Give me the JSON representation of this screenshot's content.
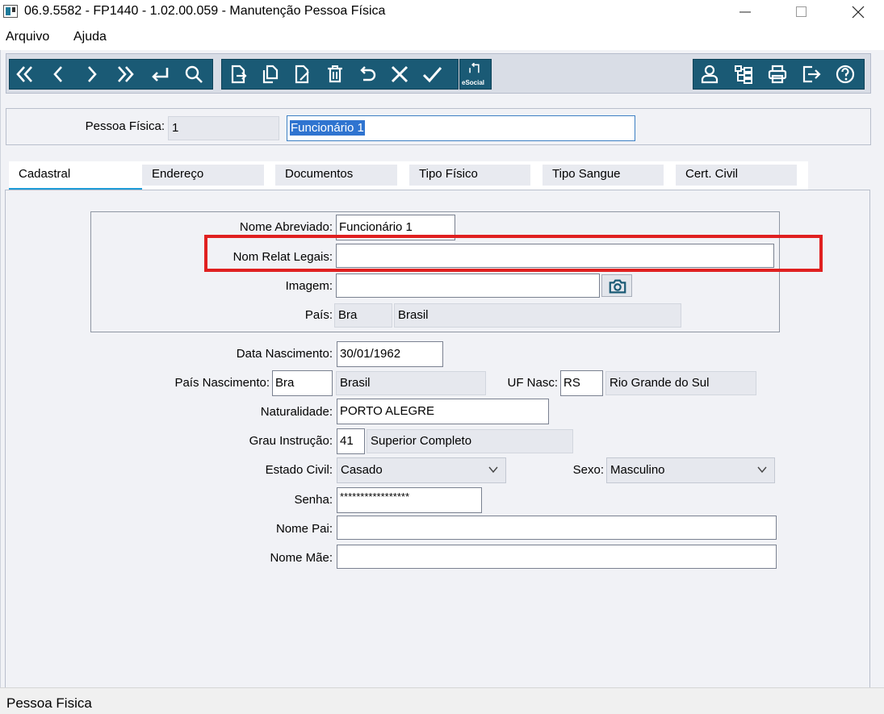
{
  "window": {
    "title": "06.9.5582 - FP1440 - 1.02.00.059 - Manutenção Pessoa Física"
  },
  "menu": {
    "items": [
      "Arquivo",
      "Ajuda"
    ]
  },
  "toolbar": {
    "nav_icons": [
      "first-record-icon",
      "previous-record-icon",
      "next-record-icon",
      "last-record-icon",
      "return-icon",
      "search-icon"
    ],
    "edit_icons": [
      "new-record-icon",
      "copy-record-icon",
      "edit-record-icon",
      "delete-record-icon",
      "undo-icon",
      "cancel-icon",
      "confirm-icon"
    ],
    "esocial_label": "eSocial",
    "right_icons": [
      "user-icon",
      "structure-icon",
      "print-icon",
      "exit-icon",
      "help-icon"
    ],
    "accent": "#1a5a75"
  },
  "person": {
    "label": "Pessoa Física:",
    "code": "1",
    "name": "Funcionário 1"
  },
  "tabs": [
    "Cadastral",
    "Endereço",
    "Documentos",
    "Tipo Físico",
    "Tipo Sangue",
    "Cert. Civil"
  ],
  "form": {
    "nome_abreviado": {
      "label": "Nome Abreviado:",
      "value": "Funcionário 1"
    },
    "nom_relat_legais": {
      "label": "Nom Relat Legais:",
      "value": ""
    },
    "imagem": {
      "label": "Imagem:",
      "value": "",
      "button_icon": "camera-icon"
    },
    "pais": {
      "label": "País:",
      "code": "Bra",
      "name": "Brasil"
    },
    "data_nascimento": {
      "label": "Data Nascimento:",
      "value": "30/01/1962"
    },
    "pais_nascimento": {
      "label": "País Nascimento:",
      "code": "Bra",
      "name": "Brasil"
    },
    "uf_nasc": {
      "label": "UF Nasc:",
      "code": "RS",
      "name": "Rio Grande do Sul"
    },
    "naturalidade": {
      "label": "Naturalidade:",
      "value": "PORTO ALEGRE"
    },
    "grau_instrucao": {
      "label": "Grau Instrução:",
      "code": "41",
      "name": "Superior Completo"
    },
    "estado_civil": {
      "label": "Estado Civil:",
      "value": "Casado"
    },
    "sexo": {
      "label": "Sexo:",
      "value": "Masculino"
    },
    "senha": {
      "label": "Senha:",
      "value": "*****************"
    },
    "nome_pai": {
      "label": "Nome Pai:",
      "value": ""
    },
    "nome_mae": {
      "label": "Nome Mãe:",
      "value": ""
    }
  },
  "highlight_color": "#e02020",
  "status": {
    "text": "Pessoa Fisica"
  }
}
